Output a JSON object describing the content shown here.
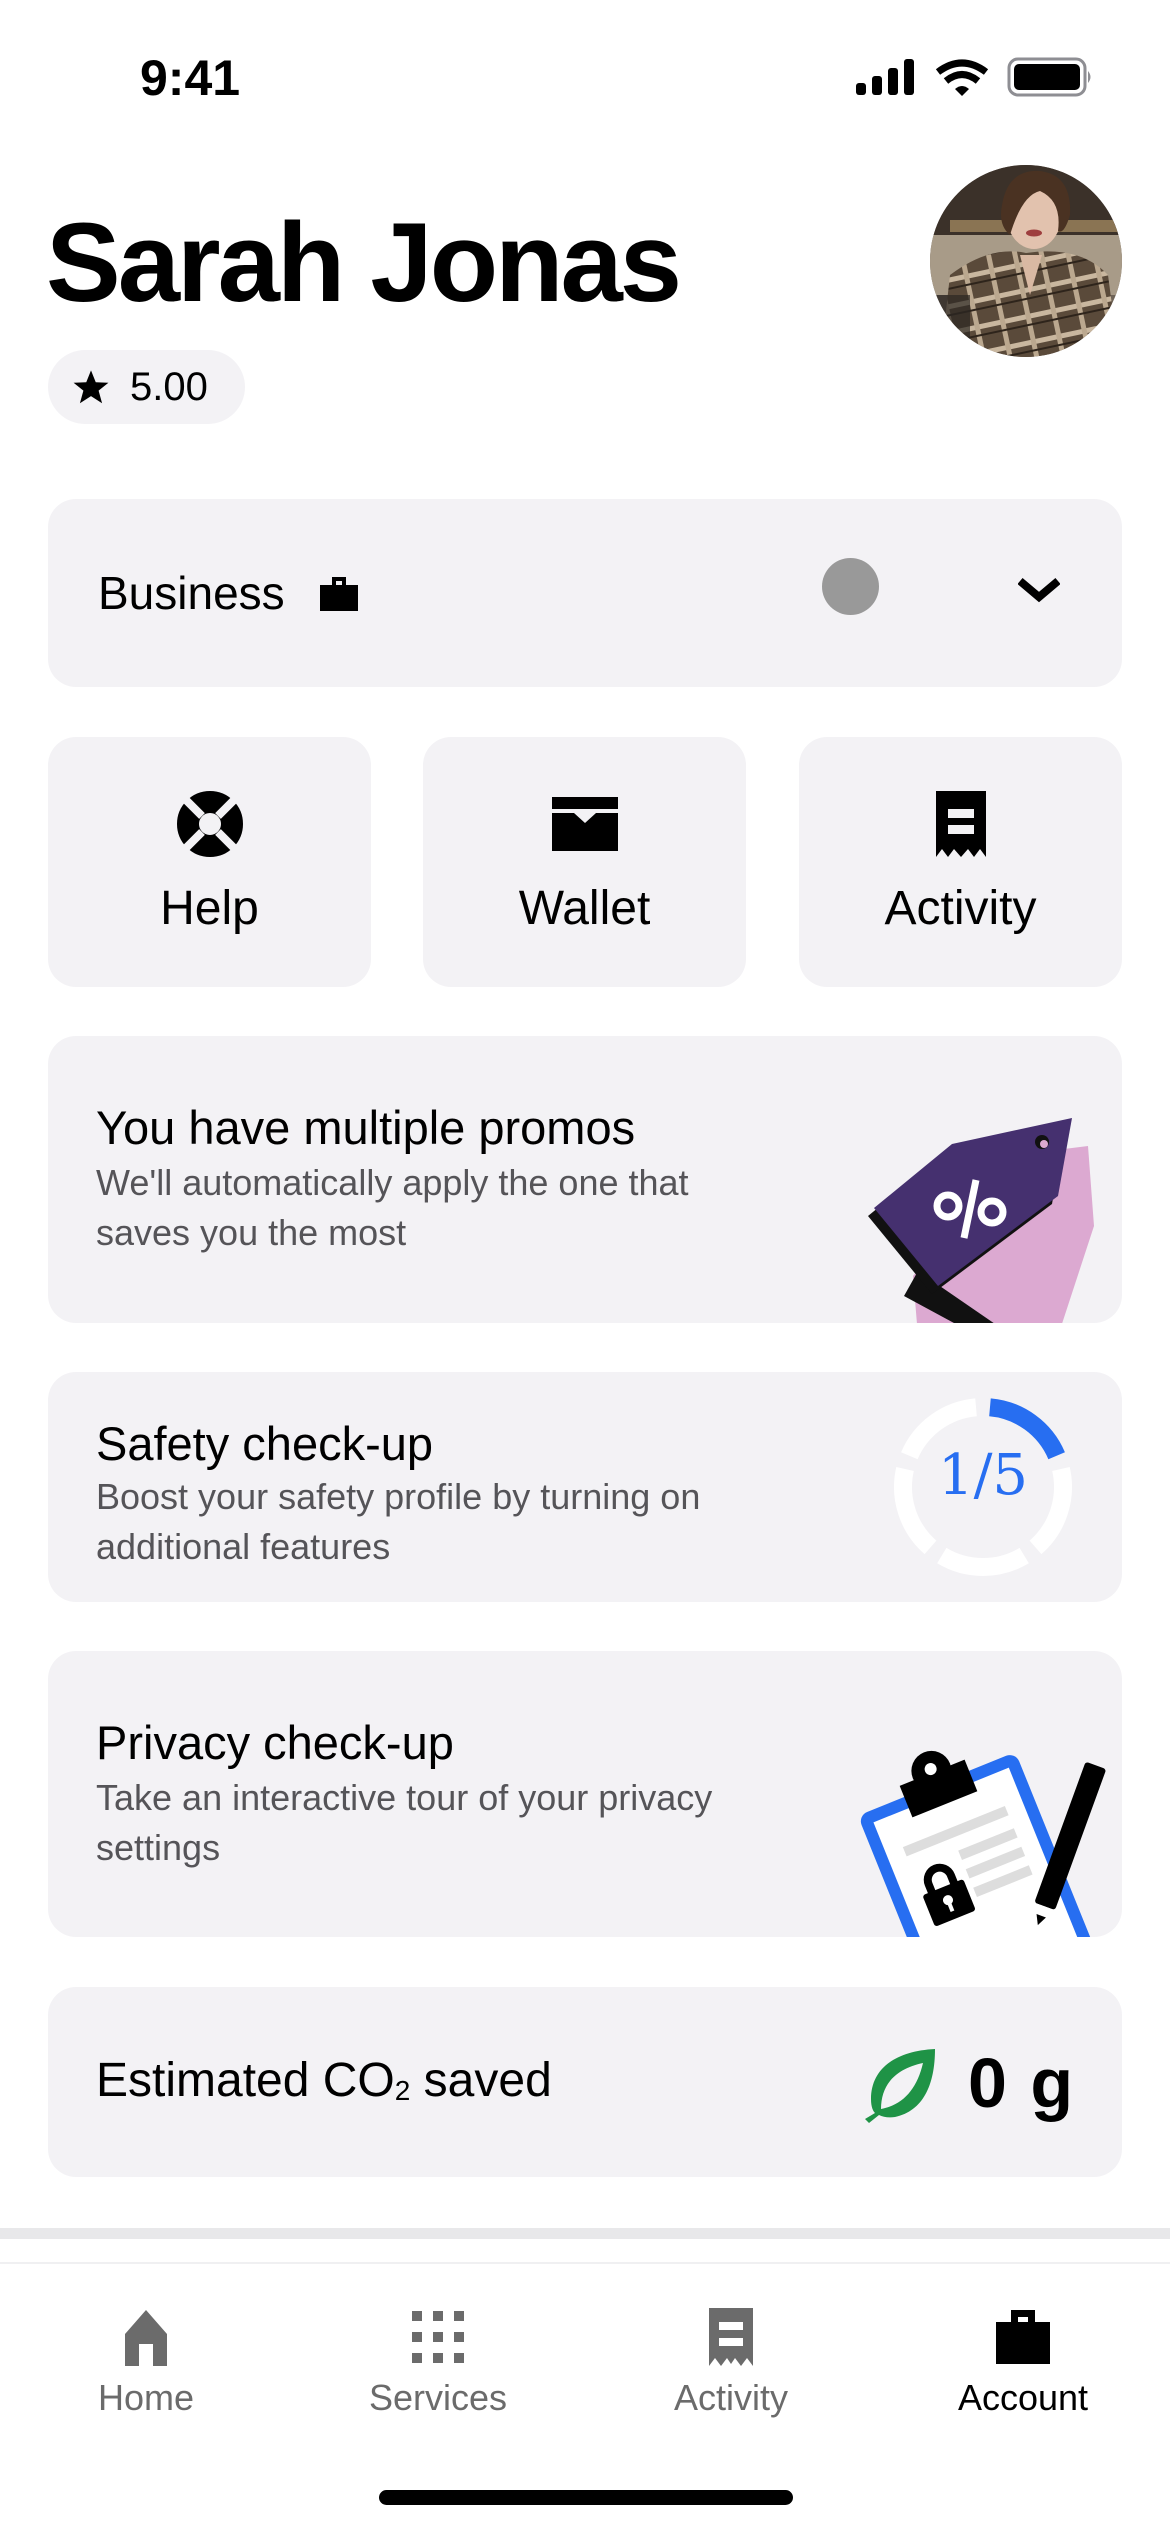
{
  "status_bar": {
    "time": "9:41",
    "icons": [
      "cellular-signal-icon",
      "wifi-icon",
      "battery-icon"
    ]
  },
  "profile": {
    "name": "Sarah Jonas",
    "rating": "5.00",
    "rating_icon": "star-icon",
    "avatar": "profile-photo"
  },
  "profile_switcher": {
    "label": "Business",
    "icon": "briefcase-icon",
    "indicator_color": "#999999",
    "expand_icon": "chevron-down-icon"
  },
  "quick_actions": [
    {
      "label": "Help",
      "icon": "lifebuoy-icon"
    },
    {
      "label": "Wallet",
      "icon": "wallet-icon"
    },
    {
      "label": "Activity",
      "icon": "receipt-icon"
    }
  ],
  "cards": {
    "promos": {
      "title": "You have multiple promos",
      "subtitle": "We'll automatically apply the one that saves you the most",
      "illustration": "promo-tag-illustration",
      "colors": {
        "tag": "#45306F",
        "tag_back": "#DCA9D1"
      }
    },
    "safety": {
      "title": "Safety check-up",
      "subtitle": "Boost your safety profile by turning on additional features",
      "progress_label": "1/5",
      "progress_completed": 1,
      "progress_total": 5,
      "accent_color": "#276EF1"
    },
    "privacy": {
      "title": "Privacy check-up",
      "subtitle": "Take an interactive tour of your privacy settings",
      "illustration": "clipboard-lock-illustration",
      "accent_color": "#276EF1"
    },
    "co2": {
      "label_prefix": "Estimated CO",
      "label_sub": "2",
      "label_suffix": " saved",
      "value": "0 g",
      "icon": "leaf-icon",
      "icon_color": "#1F9346"
    }
  },
  "bottom_nav": {
    "active": "Account",
    "items": [
      {
        "label": "Home",
        "icon": "home-icon"
      },
      {
        "label": "Services",
        "icon": "grid-icon"
      },
      {
        "label": "Activity",
        "icon": "receipt-icon"
      },
      {
        "label": "Account",
        "icon": "briefcase-icon"
      }
    ]
  }
}
